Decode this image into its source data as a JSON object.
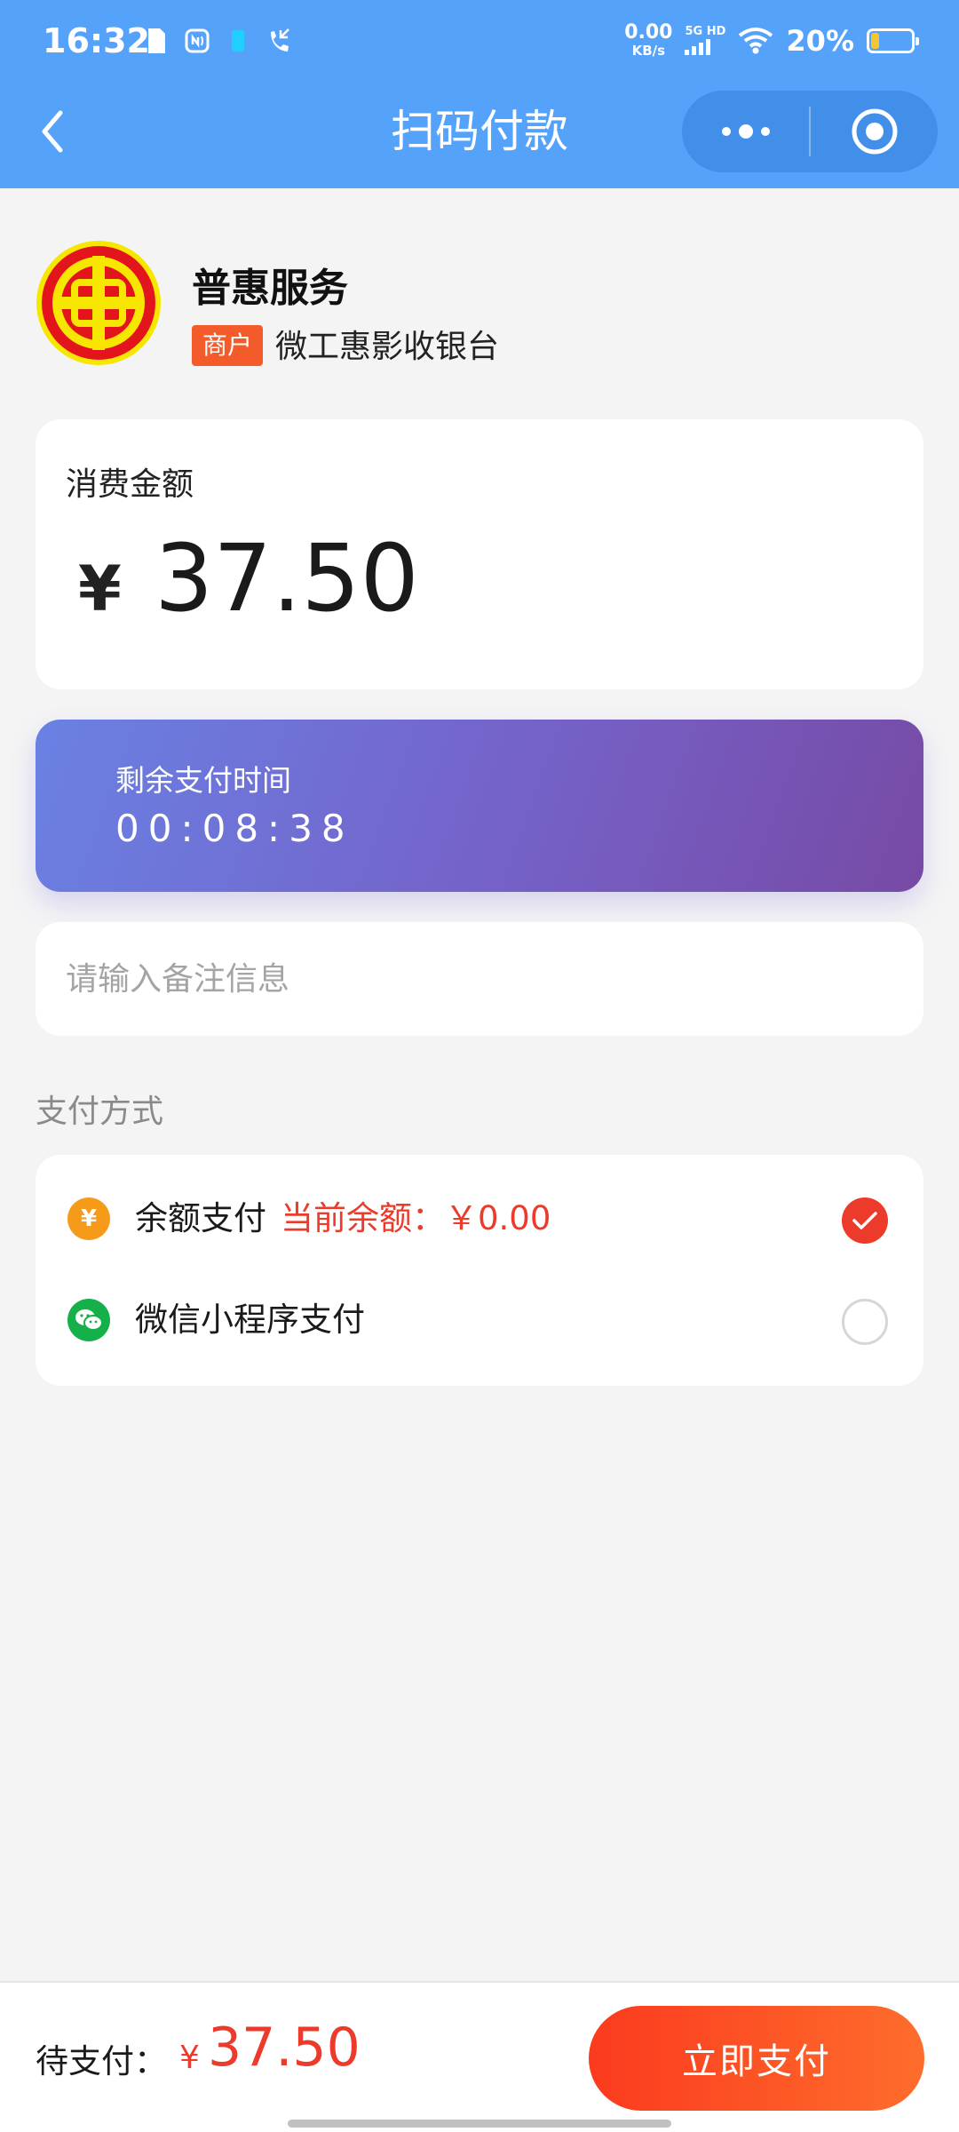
{
  "status_bar": {
    "time": "16:32",
    "net_speed_value": "0.00",
    "net_speed_unit": "KB/s",
    "signal_label": "5G HD",
    "battery_percent": "20%",
    "battery_level": 0.2,
    "left_icons": [
      "sim-card-icon",
      "nfc-icon",
      "notification-icon",
      "missed-call-icon"
    ]
  },
  "nav": {
    "title": "扫码付款",
    "back_icon": "chevron-left-icon",
    "more_icon": "more-dots-icon",
    "close_icon": "target-close-icon"
  },
  "merchant": {
    "name": "普惠服务",
    "tag": "商户",
    "cashier": "微工惠影收银台",
    "logo_icon": "union-emblem-logo"
  },
  "amount": {
    "label": "消费金额",
    "currency_symbol": "¥",
    "value": "37.50"
  },
  "timer": {
    "label": "剩余支付时间",
    "value": "00:08:38"
  },
  "remark": {
    "placeholder": "请输入备注信息",
    "value": ""
  },
  "payment": {
    "section_label": "支付方式",
    "options": [
      {
        "label": "余额支付",
        "extra": "当前余额：￥0.00",
        "icon": "coin-yen-icon",
        "selected": true
      },
      {
        "label": "微信小程序支付",
        "extra": "",
        "icon": "wechat-icon",
        "selected": false
      }
    ]
  },
  "bottom": {
    "pending_label": "待支付：",
    "currency_symbol": "¥",
    "pending_amount": "37.50",
    "pay_button": "立即支付"
  },
  "colors": {
    "header_blue": "#55a2fa",
    "accent_red": "#ec3b2b",
    "timer_gradient_start": "#6a81e3",
    "timer_gradient_end": "#774aa4",
    "button_gradient_start": "#fb3a1e",
    "button_gradient_end": "#fe6d2c"
  }
}
